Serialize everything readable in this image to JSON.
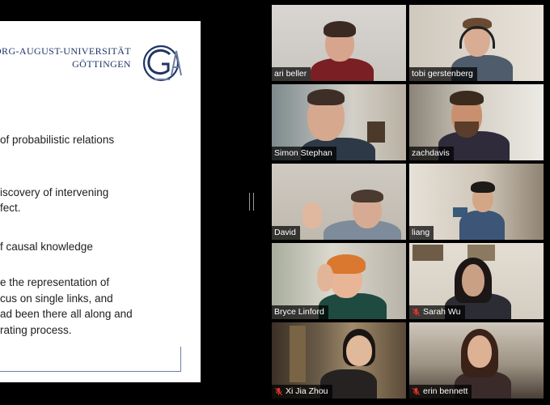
{
  "slide": {
    "university_line1": "ORG-AUGUST-UNIVERSITÄT",
    "university_line2": "GÖTTINGEN",
    "bullets": [
      "of probabilistic relations",
      "iscovery of intervening",
      "fect.",
      "f causal knowledge",
      "e the representation of",
      "cus on single links, and",
      "ad been there all along and",
      "rating process."
    ]
  },
  "participants": [
    {
      "name": "ari beller",
      "muted": false
    },
    {
      "name": "tobi gerstenberg",
      "muted": false
    },
    {
      "name": "Simon Stephan",
      "muted": false
    },
    {
      "name": "zachdavis",
      "muted": false
    },
    {
      "name": "David",
      "muted": false
    },
    {
      "name": "liang",
      "muted": false
    },
    {
      "name": "Bryce Linford",
      "muted": false
    },
    {
      "name": "Sarah Wu",
      "muted": true
    },
    {
      "name": "Xi Jia Zhou",
      "muted": true
    },
    {
      "name": "erin bennett",
      "muted": true
    }
  ],
  "colors": {
    "background": "#000000",
    "slide_text": "#202020",
    "university_blue": "#1f3566",
    "muted_red": "#e0342b",
    "active_speaker": "#2dbf3b"
  }
}
